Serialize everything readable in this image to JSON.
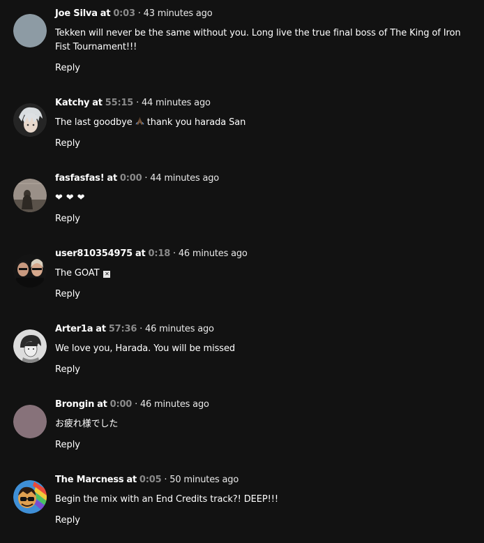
{
  "comments": [
    {
      "username": "Joe Silva",
      "at": "at",
      "timestamp": "0:03",
      "time_ago": "· 43 minutes ago",
      "text": "Tekken will never be the same without you. Long live the true final boss of The King of Iron Fist Tournament!!!",
      "reply_label": "Reply",
      "avatar_color": "#8c9aa3"
    },
    {
      "username": "Katchy",
      "at": "at",
      "timestamp": "55:15",
      "time_ago": "· 44 minutes ago",
      "text_before": "The last goodbye",
      "text_after": "thank you harada San",
      "emoji": "folded-hands-emoji",
      "reply_label": "Reply",
      "avatar_color": "#2a2a2a"
    },
    {
      "username": "fasfasfas!",
      "at": "at",
      "timestamp": "0:00",
      "time_ago": "· 44 minutes ago",
      "hearts": [
        "❤",
        "❤",
        "❤"
      ],
      "reply_label": "Reply",
      "avatar_color": "#6b6258"
    },
    {
      "username": "user810354975",
      "at": "at",
      "timestamp": "0:18",
      "time_ago": "· 46 minutes ago",
      "text": "The GOAT",
      "trailing_glyph": "✕",
      "reply_label": "Reply",
      "avatar_color": "#1e1e1e"
    },
    {
      "username": "Arter1a",
      "at": "at",
      "timestamp": "57:36",
      "time_ago": "· 46 minutes ago",
      "text": "We love you, Harada. You will be missed",
      "reply_label": "Reply",
      "avatar_color": "#d8d8d8"
    },
    {
      "username": "Brongin",
      "at": "at",
      "timestamp": "0:00",
      "time_ago": "· 46 minutes ago",
      "text": "お疲れ様でした",
      "reply_label": "Reply",
      "avatar_color": "#8a7479"
    },
    {
      "username": "The Marcness",
      "at": "at",
      "timestamp": "0:05",
      "time_ago": "· 50 minutes ago",
      "text": "Begin the mix with an End Credits track?! DEEP!!!",
      "reply_label": "Reply",
      "avatar_color": "#4a90c8"
    }
  ]
}
